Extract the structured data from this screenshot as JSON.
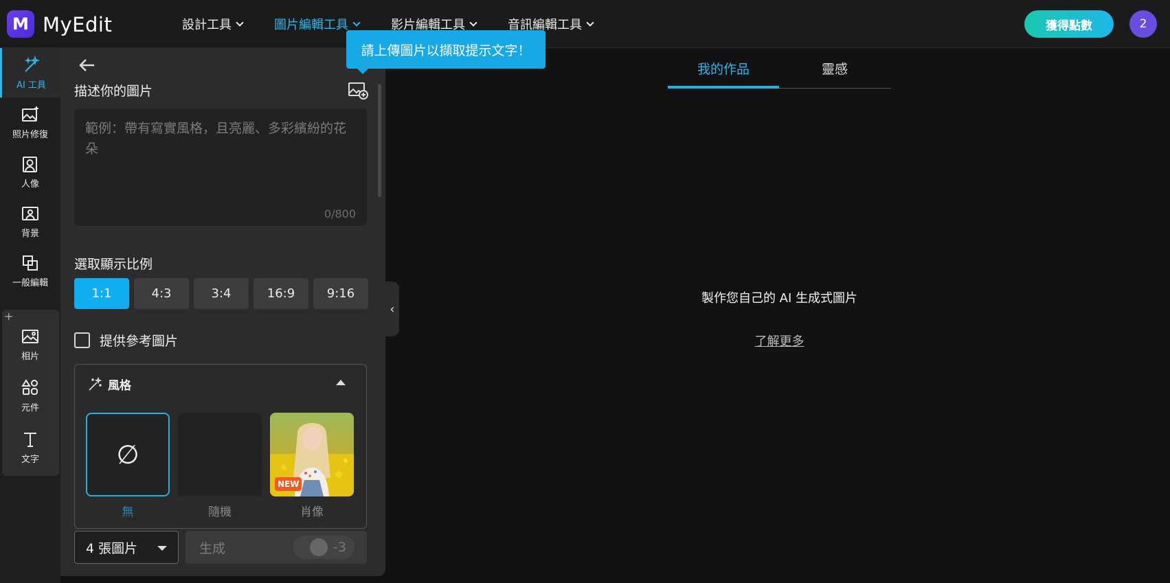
{
  "brand": {
    "name": "MyEdit",
    "logo_letter": "M"
  },
  "nav": {
    "items": [
      {
        "label": "設計工具"
      },
      {
        "label": "圖片編輯工具"
      },
      {
        "label": "影片編輯工具"
      },
      {
        "label": "音訊編輯工具"
      }
    ],
    "active_index": 1
  },
  "header": {
    "get_points_label": "獲得點數",
    "avatar_text": "2"
  },
  "rail": {
    "items": [
      {
        "label": "AI 工具",
        "icon": "magic-wand-icon"
      },
      {
        "label": "照片修復",
        "icon": "photo-restore-icon"
      },
      {
        "label": "人像",
        "icon": "portrait-icon"
      },
      {
        "label": "背景",
        "icon": "background-icon"
      },
      {
        "label": "一般編輯",
        "icon": "crop-icon"
      },
      {
        "label": "相片",
        "icon": "photo-icon"
      },
      {
        "label": "元件",
        "icon": "shapes-icon"
      },
      {
        "label": "文字",
        "icon": "text-icon"
      }
    ],
    "group_plus": "+"
  },
  "panel": {
    "describe_title": "描述你的圖片",
    "prompt_placeholder": "範例：帶有寫實風格，且亮麗、多彩繽紛的花朵",
    "char_count": "0/800",
    "ratio_title": "選取顯示比例",
    "ratios": [
      "1:1",
      "4:3",
      "3:4",
      "16:9",
      "9:16"
    ],
    "selected_ratio": "1:1",
    "reference_label": "提供參考圖片",
    "style": {
      "title": "風格",
      "tiles": [
        {
          "label": "無",
          "glyph": "∅"
        },
        {
          "label": "隨機"
        },
        {
          "label": "肖像",
          "badge": "NEW"
        }
      ]
    },
    "image_count": "4 張圖片",
    "generate_label": "生成",
    "generate_cost": "-3"
  },
  "tooltip": {
    "text": "請上傳圖片以擷取提示文字！"
  },
  "main": {
    "tabs": [
      {
        "label": "我的作品"
      },
      {
        "label": "靈感"
      }
    ],
    "message": "製作您自己的 AI 生成式圖片",
    "learn_more": "了解更多"
  },
  "colors": {
    "accent": "#1fb0ec",
    "badge": "#f25a1f",
    "brand": "#5a34e6"
  }
}
